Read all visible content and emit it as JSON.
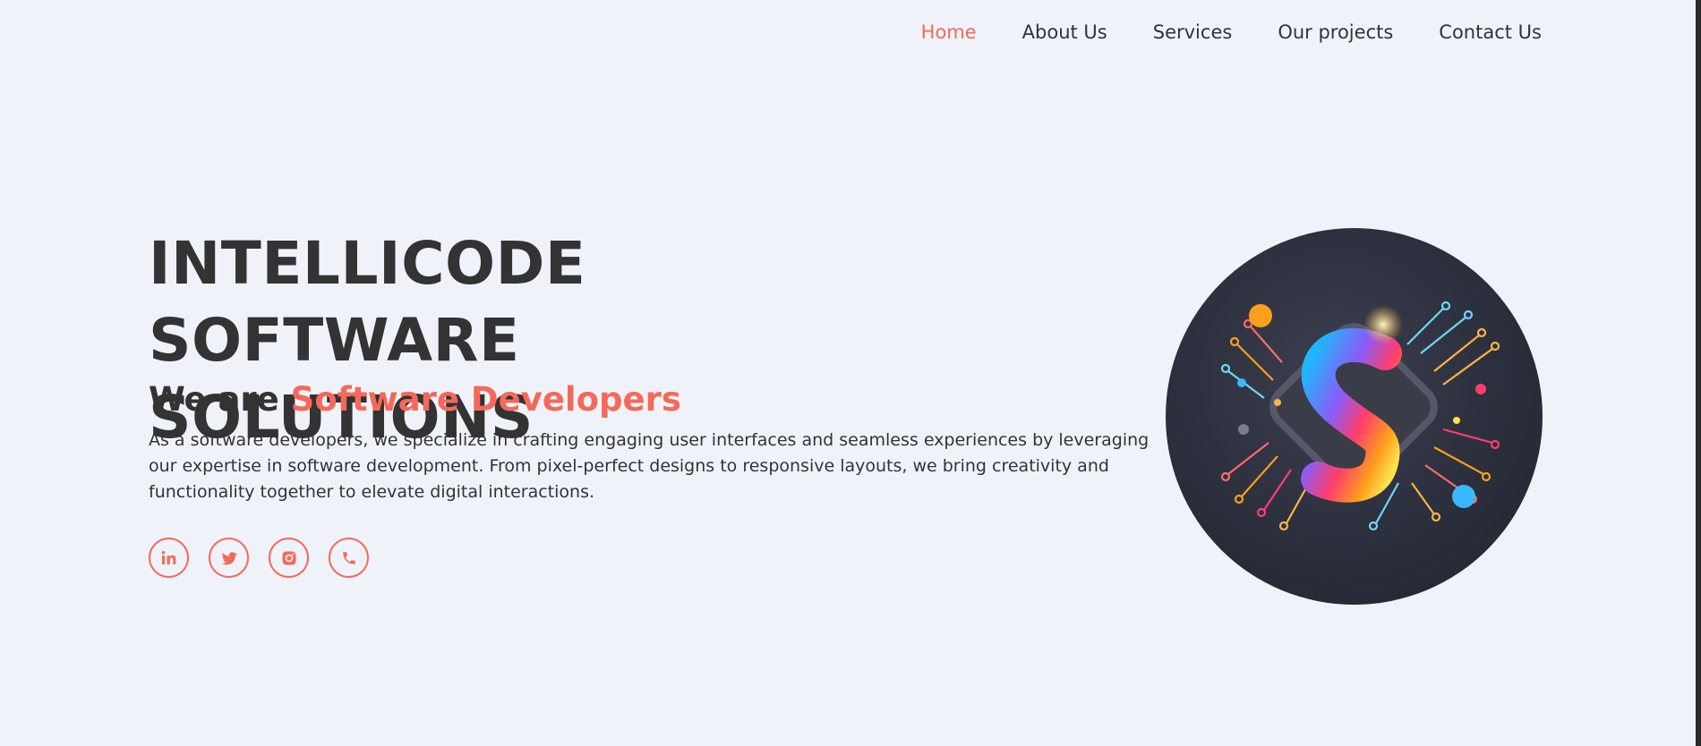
{
  "nav": {
    "items": [
      {
        "label": "Home",
        "active": true
      },
      {
        "label": "About Us",
        "active": false
      },
      {
        "label": "Services",
        "active": false
      },
      {
        "label": "Our projects",
        "active": false
      },
      {
        "label": "Contact Us",
        "active": false
      }
    ]
  },
  "hero": {
    "title_line1": "INTELLICODE SOFTWARE",
    "title_line2": "SOLUTIONS",
    "subtitle_prefix": "We are",
    "subtitle_accent": "Software Developers",
    "description": "As a software developers, we specialize in crafting engaging user interfaces and seamless experiences by leveraging our expertise in software development. From pixel-perfect designs to responsive layouts, we bring creativity and functionality together to elevate digital interactions."
  },
  "socials": [
    {
      "icon": "linkedin-icon"
    },
    {
      "icon": "twitter-icon"
    },
    {
      "icon": "instagram-icon"
    },
    {
      "icon": "phone-icon"
    }
  ],
  "colors": {
    "accent": "#f5695b",
    "text": "#333333",
    "background": "#eff3f9"
  }
}
